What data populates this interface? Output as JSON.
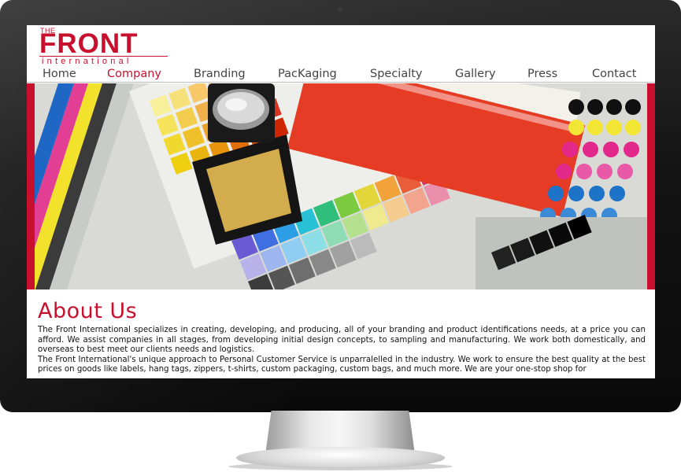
{
  "site": {
    "logo": {
      "the": "THE",
      "front": "FRONT",
      "international": "international"
    },
    "brand_color": "#c8102e"
  },
  "nav": {
    "items": [
      {
        "label": "Home",
        "active": false
      },
      {
        "label": "Company",
        "active": true
      },
      {
        "label": "Branding",
        "active": false
      },
      {
        "label": "PacKaging",
        "active": false
      },
      {
        "label": "Specialty",
        "active": false
      },
      {
        "label": "Gallery",
        "active": false
      },
      {
        "label": "Press",
        "active": false
      },
      {
        "label": "Contact",
        "active": false
      }
    ]
  },
  "hero": {
    "image": "color-proof-swatches-with-loupe-and-books"
  },
  "about": {
    "heading": "About Us",
    "paragraph1": "The Front International specializes in creating, developing, and producing, all of your branding and product identifications needs, at a price you can afford. We assist companies in all stages, from developing initial design concepts, to sampling and manufacturing. We work both domestically, and overseas to best meet our clients needs and logistics.",
    "paragraph2": "The Front International's unique approach to Personal Customer Service is unparralelled in the industry. We work to ensure the best quality at the best prices on goods like labels, hang tags, zippers, t-shirts, custom packaging, custom bags, and much more. We are your one-stop shop for"
  }
}
